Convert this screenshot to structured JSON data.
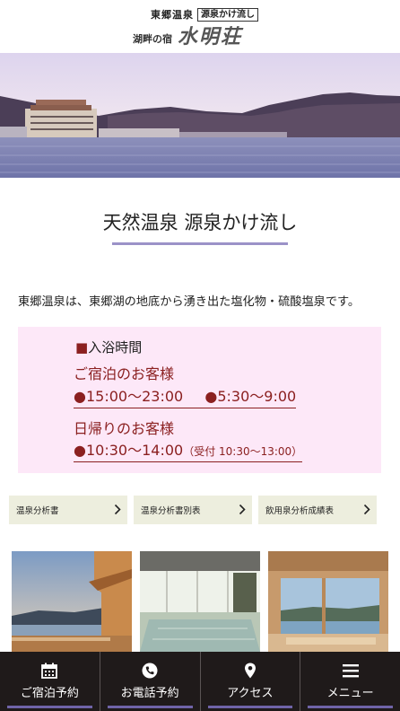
{
  "header": {
    "onsen_name": "東郷温泉",
    "tag": "源泉かけ流し",
    "subtitle": "湖畔の宿",
    "brand": "水明荘"
  },
  "main": {
    "title": "天然温泉 源泉かけ流し",
    "intro": "東郷温泉は、東郷湖の地底から湧き出た塩化物・硫酸塩泉です。"
  },
  "bath_times": {
    "heading_marker": "■",
    "heading": "入浴時間",
    "stay": {
      "title": "ご宿泊のお客様",
      "time1": "15:00〜23:00",
      "time2": "5:30〜9:00"
    },
    "day": {
      "title": "日帰りのお客様",
      "time": "10:30〜14:00",
      "note": "（受付 10:30〜13:00）"
    },
    "bullet": "●"
  },
  "analysis_buttons": [
    {
      "label": "温泉分析書"
    },
    {
      "label": "温泉分析書別表"
    },
    {
      "label": "飲用泉分析成績表"
    }
  ],
  "bottom_nav": [
    {
      "label": "ご宿泊予約",
      "icon": "calendar-icon"
    },
    {
      "label": "お電話予約",
      "icon": "phone-icon"
    },
    {
      "label": "アクセス",
      "icon": "map-pin-icon"
    },
    {
      "label": "メニュー",
      "icon": "hamburger-menu-icon"
    }
  ],
  "colors": {
    "accent_purple": "#9b92c8",
    "dark_red": "#8b2020",
    "pink_box": "#fde8f8",
    "nav_bg": "#1f1a1a",
    "nav_underline": "#6f63a8"
  }
}
